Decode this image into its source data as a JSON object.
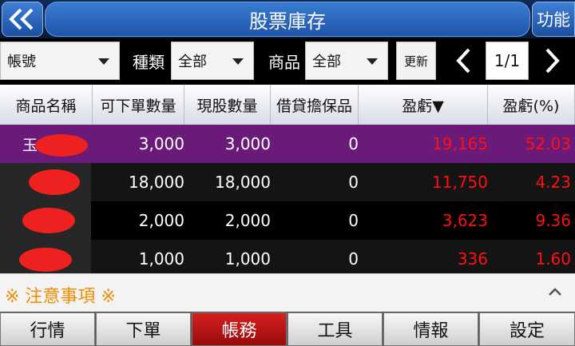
{
  "header": {
    "back_icon": "double-chevron-left-icon",
    "title": "股票庫存",
    "function_label": "功能"
  },
  "filters": {
    "account_value": "帳號",
    "type_label": "種類",
    "type_value": "全部",
    "product_label": "商品",
    "product_value": "全部",
    "refresh_label": "更新",
    "page": "1/1"
  },
  "table": {
    "columns": [
      "商品名稱",
      "可下單數量",
      "現股數量",
      "借貸擔保品",
      "盈虧▼",
      "盈虧(%)"
    ],
    "rows": [
      {
        "name": "玉",
        "orderable_qty": "3,000",
        "cash_qty": "3,000",
        "collateral": "0",
        "pnl": "19,165",
        "pnl_pct": "52.03"
      },
      {
        "name": "",
        "orderable_qty": "18,000",
        "cash_qty": "18,000",
        "collateral": "0",
        "pnl": "11,750",
        "pnl_pct": "4.23"
      },
      {
        "name": "",
        "orderable_qty": "2,000",
        "cash_qty": "2,000",
        "collateral": "0",
        "pnl": "3,623",
        "pnl_pct": "9.36"
      },
      {
        "name": "",
        "orderable_qty": "1,000",
        "cash_qty": "1,000",
        "collateral": "0",
        "pnl": "336",
        "pnl_pct": "1.60"
      }
    ]
  },
  "notice": {
    "label": "※ 注意事項 ※",
    "toggle_icon": "chevron-up-icon"
  },
  "bottom_nav": {
    "tabs": [
      "行情",
      "下單",
      "帳務",
      "工具",
      "情報",
      "設定"
    ],
    "active_index": 2
  },
  "colors": {
    "highlight_row": "#6a1b7a",
    "profit": "#ff1010",
    "notice": "#f08c00",
    "active_tab": "#c41414"
  }
}
